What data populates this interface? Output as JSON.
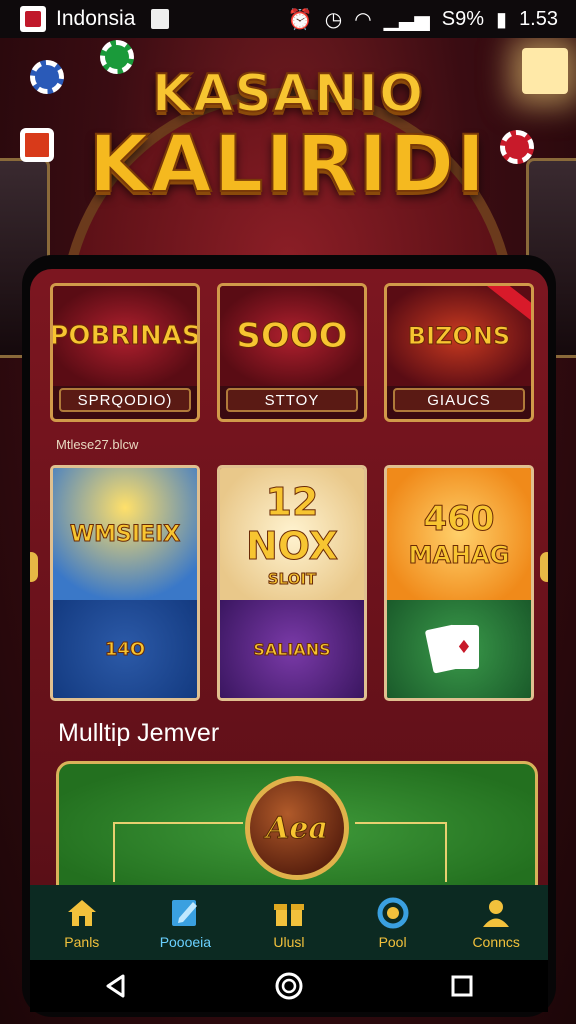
{
  "status_bar": {
    "carrier": "Indonsia",
    "battery": "S9%",
    "time": "1.53"
  },
  "logo": {
    "line1": "KASANIO",
    "line2": "KALIRIDI"
  },
  "featured_games": [
    {
      "art_text": "POBRINAS",
      "label": "SPRQODIO)"
    },
    {
      "art_text": "SOOO",
      "label": "STTOY"
    },
    {
      "art_text": "BIZONS",
      "label": "GIAUCS"
    }
  ],
  "section_caption": "Mtlese27.blcw",
  "slot_games": [
    {
      "top_text": "WMSIEIX",
      "bottom_text": "14O"
    },
    {
      "top_text": "12",
      "top_sub": "NOX",
      "top_sub2": "SLOIT",
      "bottom_text": "SALIANS"
    },
    {
      "top_text": "460",
      "top_sub": "MAHAG",
      "bottom_text": ""
    }
  ],
  "multiplayer": {
    "heading": "Mulltip Jemver",
    "badge_text": "Aea"
  },
  "bottom_nav": [
    {
      "label": "Panls",
      "icon": "home-icon"
    },
    {
      "label": "Poooeia",
      "icon": "edit-icon",
      "active": true
    },
    {
      "label": "Ulusl",
      "icon": "gift-icon"
    },
    {
      "label": "Pool",
      "icon": "circle-icon"
    },
    {
      "label": "Conncs",
      "icon": "person-icon"
    }
  ],
  "colors": {
    "gold": "#f7c531",
    "panel_red": "#7c1620",
    "nav_bg": "#0c2a22",
    "active_blue": "#6ad0ff"
  }
}
